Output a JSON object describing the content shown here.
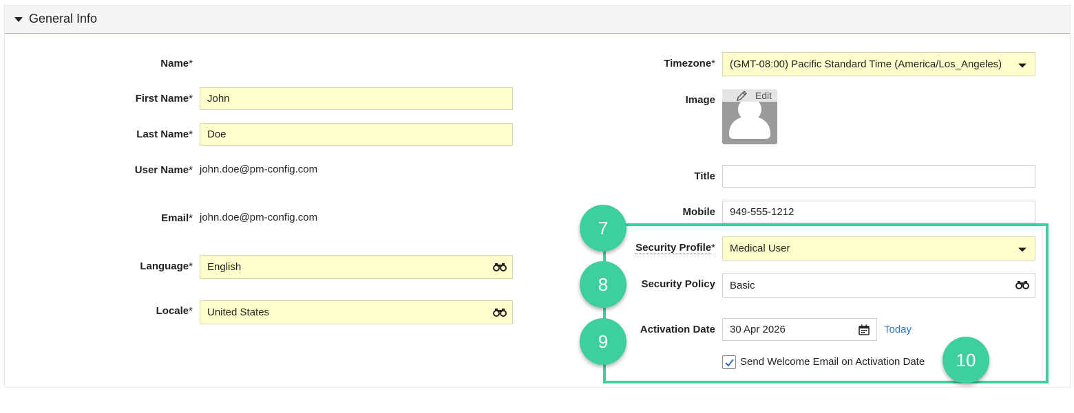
{
  "section": {
    "title": "General Info"
  },
  "left": {
    "name_label": "Name",
    "first_name_label": "First Name",
    "first_name_value": "John",
    "last_name_label": "Last Name",
    "last_name_value": "Doe",
    "user_name_label": "User Name",
    "user_name_value": "john.doe@pm-config.com",
    "email_label": "Email",
    "email_value": "john.doe@pm-config.com",
    "language_label": "Language",
    "language_value": "English",
    "locale_label": "Locale",
    "locale_value": "United States"
  },
  "right": {
    "timezone_label": "Timezone",
    "timezone_value": "(GMT-08:00) Pacific Standard Time (America/Los_Angeles)",
    "image_label": "Image",
    "image_edit_label": "Edit",
    "title_label": "Title",
    "title_value": "",
    "mobile_label": "Mobile",
    "mobile_value": "949-555-1212",
    "security_profile_label": "Security Profile",
    "security_profile_value": "Medical User",
    "security_policy_label": "Security Policy",
    "security_policy_value": "Basic",
    "activation_date_label": "Activation Date",
    "activation_date_value": "30 Apr 2026",
    "today_link": "Today",
    "welcome_email_label": "Send Welcome Email on Activation Date",
    "welcome_email_checked": true
  },
  "required_marker": "*",
  "steps": [
    "7",
    "8",
    "9",
    "10"
  ],
  "colors": {
    "required_bg": "#ffffcc",
    "highlight": "#3ecf9e",
    "header_border": "#e8a45a",
    "link": "#2a6ebb"
  }
}
